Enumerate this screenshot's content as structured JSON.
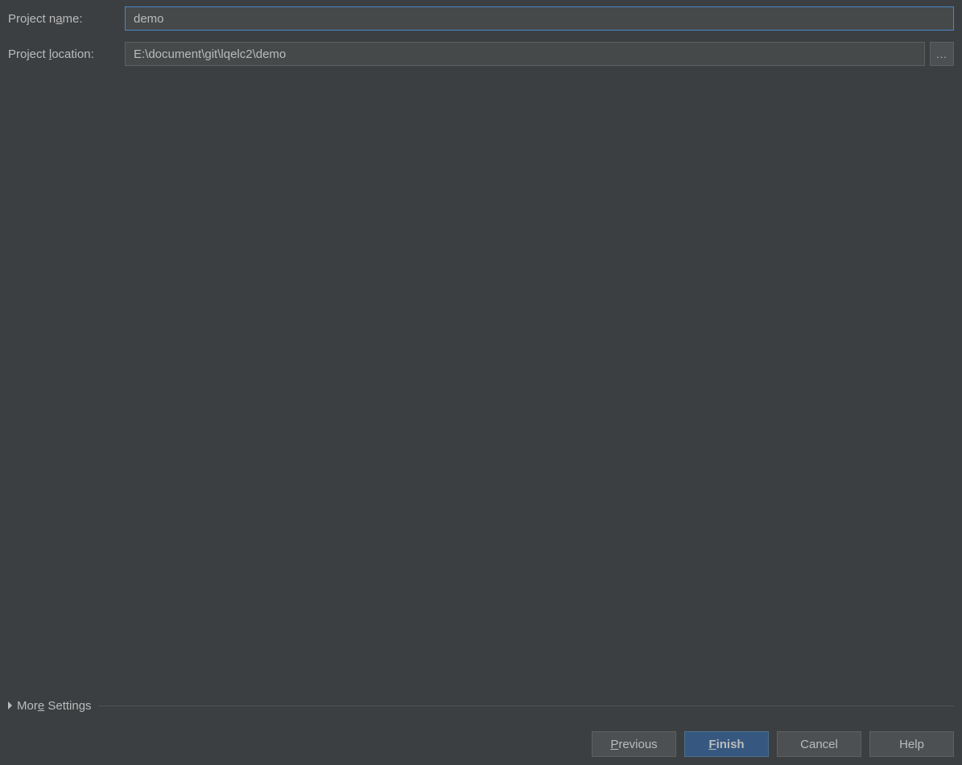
{
  "form": {
    "project_name": {
      "label_pre": "Project n",
      "label_mnemonic": "a",
      "label_post": "me:",
      "value": "demo"
    },
    "project_location": {
      "label_pre": "Project ",
      "label_mnemonic": "l",
      "label_post": "ocation:",
      "value": "E:\\document\\git\\lqelc2\\demo"
    },
    "browse_label": "..."
  },
  "more_settings": {
    "pre": "Mor",
    "mnemonic": "e",
    "post": " Settings"
  },
  "footer": {
    "previous": {
      "mnemonic": "P",
      "post": "revious"
    },
    "finish": {
      "mnemonic": "F",
      "post": "inish"
    },
    "cancel": "Cancel",
    "help": "Help"
  }
}
